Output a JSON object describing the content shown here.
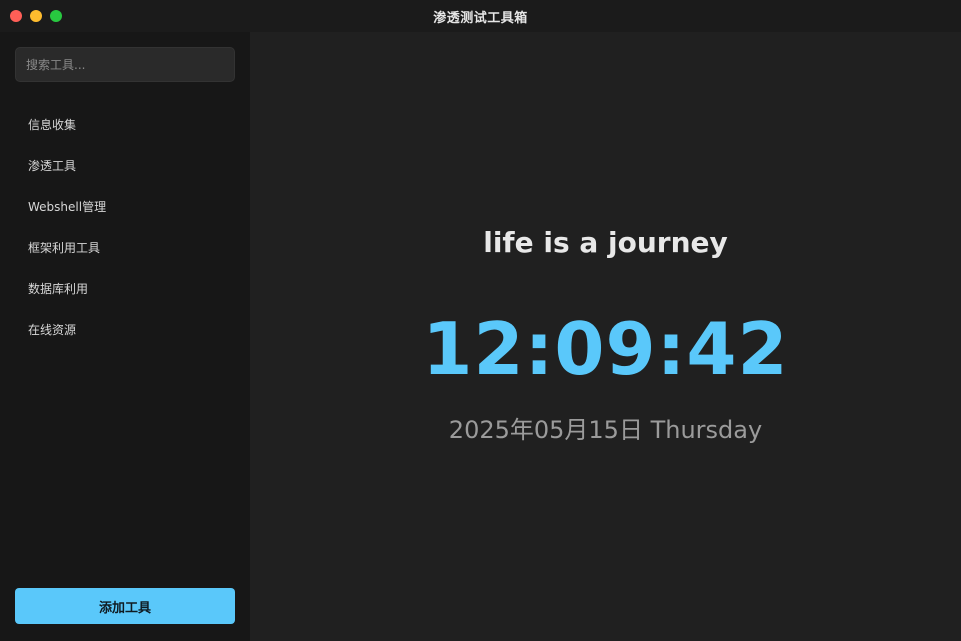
{
  "window": {
    "title": "渗透测试工具箱"
  },
  "sidebar": {
    "search_placeholder": "搜索工具...",
    "items": [
      {
        "label": "信息收集"
      },
      {
        "label": "渗透工具"
      },
      {
        "label": "Webshell管理"
      },
      {
        "label": "框架利用工具"
      },
      {
        "label": "数据库利用"
      },
      {
        "label": "在线资源"
      }
    ],
    "add_button_label": "添加工具"
  },
  "main": {
    "quote": "life is a journey",
    "time": "12:09:42",
    "date": "2025年05月15日 Thursday"
  },
  "colors": {
    "accent": "#5ac8fa",
    "sidebar_bg": "#171717",
    "main_bg": "#202020"
  }
}
